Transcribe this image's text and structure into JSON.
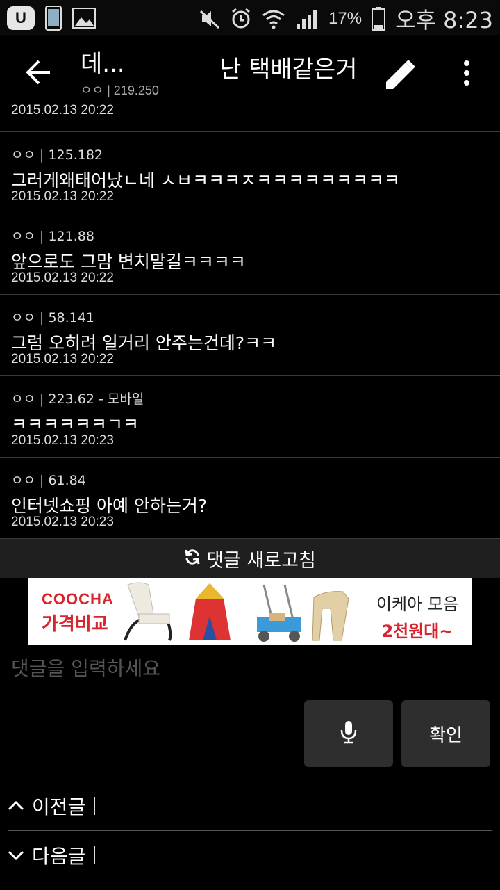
{
  "status_bar": {
    "app_icon_text": "U",
    "battery_percent": "17%",
    "time": "오후 8:23"
  },
  "header": {
    "author_name": "데...",
    "author_meta": "ㅇㅇ | 219.250",
    "post_title": "난 택배같은거"
  },
  "comments": {
    "partial_date": "2015.02.13 20:22",
    "items": [
      {
        "meta": "ㅇㅇ | 125.182",
        "body": "그러게왜태어났ㄴ네 ㅅㅂㅋㅋㅋㅈㅋㅋㅋㅋㅋㅋㅋㅋㅋ",
        "date": "2015.02.13 20:22"
      },
      {
        "meta": "ㅇㅇ | 121.88",
        "body": "앞으로도 그맘 변치말길ㅋㅋㅋㅋ",
        "date": "2015.02.13 20:22"
      },
      {
        "meta": "ㅇㅇ | 58.141",
        "body": "그럼 오히려 일거리 안주는건데?ㅋㅋ",
        "date": "2015.02.13 20:22"
      },
      {
        "meta": "ㅇㅇ | 223.62 - 모바일",
        "body": "ㅋㅋㅋㅋㅋㅋㄱㅋ",
        "date": "2015.02.13 20:23"
      },
      {
        "meta": "ㅇㅇ | 61.84",
        "body": "인터넷쇼핑 아예 안하는거?",
        "date": "2015.02.13 20:23"
      }
    ]
  },
  "refresh": {
    "label": "댓글 새로고침"
  },
  "ad": {
    "brand_top": "COOCHA",
    "brand_bottom": "가격비교",
    "text_line1": "이케아 모음",
    "text_line2": "2천원대~"
  },
  "input": {
    "placeholder": "댓글을 입력하세요"
  },
  "buttons": {
    "confirm_label": "확인"
  },
  "nav": {
    "prev_label": "이전글",
    "next_label": "다음글"
  },
  "colors": {
    "background": "#000000",
    "ad_red": "#d9232d",
    "button_bg": "#2e2e2e"
  }
}
